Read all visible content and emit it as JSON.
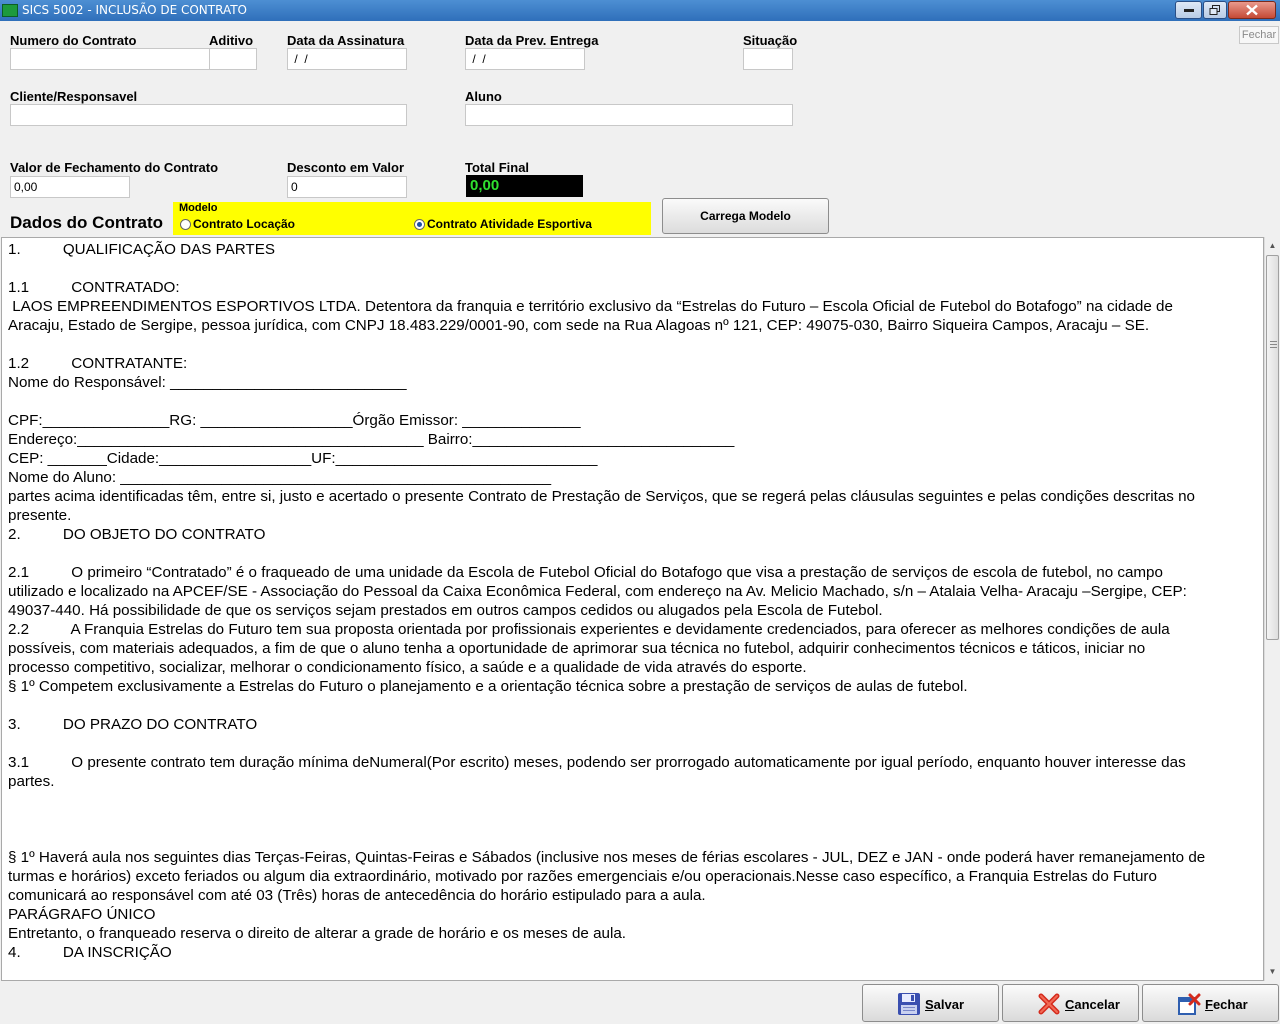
{
  "window": {
    "title": "SICS 5002 - INCLUSÃO DE CONTRATO"
  },
  "form": {
    "numero_label": "Numero do Contrato",
    "numero_value": "",
    "aditivo_label": "Aditivo",
    "aditivo_value": "",
    "data_assinatura_label": "Data da Assinatura",
    "data_assinatura_value": " /  /",
    "data_prev_label": "Data da Prev. Entrega",
    "data_prev_value": " /  /",
    "situacao_label": "Situação",
    "situacao_value": "",
    "cliente_label": "Cliente/Responsavel",
    "cliente_value": "",
    "aluno_label": "Aluno",
    "aluno_value": "",
    "valor_label": "Valor de Fechamento do Contrato",
    "valor_value": "0,00",
    "desconto_label": "Desconto em Valor",
    "desconto_value": "0",
    "total_label": "Total Final",
    "total_value": "0,00",
    "fechar_hint": "Fechar"
  },
  "dados": {
    "title": "Dados do Contrato",
    "modelo_caption": "Modelo",
    "option_locacao": "Contrato Locação",
    "option_atividade": "Contrato Atividade Esportiva",
    "selected": "Contrato Atividade Esportiva",
    "carrega_button": "Carrega Modelo"
  },
  "contract_lines": [
    "1.          QUALIFICAÇÃO DAS PARTES",
    "",
    "1.1          CONTRATADO:",
    " LAOS EMPREENDIMENTOS ESPORTIVOS LTDA. Detentora da franquia e território exclusivo da “Estrelas do Futuro – Escola Oficial de Futebol do Botafogo” na cidade de",
    "Aracaju, Estado de Sergipe, pessoa jurídica, com CNPJ 18.483.229/0001-90, com sede na Rua Alagoas nº 121, CEP: 49075-030, Bairro Siqueira Campos, Aracaju – SE.",
    "",
    "1.2          CONTRATANTE:",
    "Nome do Responsável: ____________________________",
    "",
    "CPF:_______________RG: __________________Órgão Emissor: ______________",
    "Endereço:_________________________________________ Bairro:_______________________________",
    "CEP: _______Cidade:__________________UF:_______________________________",
    "Nome do Aluno: ___________________________________________________",
    "partes acima identificadas têm, entre si, justo e acertado o presente Contrato de Prestação de Serviços, que se regerá pelas cláusulas seguintes e pelas condições descritas no",
    "presente.",
    "2.          DO OBJETO DO CONTRATO",
    "",
    "2.1          O primeiro “Contratado” é o fraqueado de uma unidade da Escola de Futebol Oficial do Botafogo que visa a prestação de serviços de escola de futebol, no campo",
    "utilizado e localizado na APCEF/SE - Associação do Pessoal da Caixa Econômica Federal, com endereço na Av. Melicio Machado, s/n – Atalaia Velha- Aracaju –Sergipe, CEP:",
    "49037-440. Há possibilidade de que os serviços sejam prestados em outros campos cedidos ou alugados pela Escola de Futebol.",
    "2.2          A Franquia Estrelas do Futuro tem sua proposta orientada por profissionais experientes e devidamente credenciados, para oferecer as melhores condições de aula",
    "possíveis, com materiais adequados, a fim de que o aluno tenha a oportunidade de aprimorar sua técnica no futebol, adquirir conhecimentos técnicos e táticos, iniciar no",
    "processo competitivo, socializar, melhorar o condicionamento físico, a saúde e a qualidade de vida através do esporte.",
    "§ 1º Competem exclusivamente a Estrelas do Futuro o planejamento e a orientação técnica sobre a prestação de serviços de aulas de futebol.",
    "",
    "3.          DO PRAZO DO CONTRATO",
    "",
    "3.1          O presente contrato tem duração mínima deNumeral(Por escrito) meses, podendo ser prorrogado automaticamente por igual período, enquanto houver interesse das",
    "partes.",
    "",
    "",
    "",
    "§ 1º Haverá aula nos seguintes dias Terças-Feiras, Quintas-Feiras e Sábados (inclusive nos meses de férias escolares - JUL, DEZ e JAN - onde poderá haver remanejamento de",
    "turmas e horários) exceto feriados ou algum dia extraordinário, motivado por razões emergenciais e/ou operacionais.Nesse caso específico, a Franquia Estrelas do Futuro",
    "comunicará ao responsável com até 03 (Três) horas de antecedência do horário estipulado para a aula.",
    "PARÁGRAFO ÚNICO",
    "Entretanto, o franqueado reserva o direito de alterar a grade de horário e os meses de aula.",
    "4.          DA INSCRIÇÃO"
  ],
  "buttons": {
    "salvar_first": "S",
    "salvar_rest": "alvar",
    "cancelar_first": "C",
    "cancelar_rest": "ancelar",
    "fechar_first": "F",
    "fechar_rest": "echar"
  },
  "icons": {
    "app": "app-icon",
    "salvar": "floppy-disk-icon",
    "cancelar": "red-x-icon",
    "fechar": "exit-door-icon"
  },
  "colors": {
    "modelo_bg": "#ffff00",
    "total_bg": "#000000",
    "total_fg": "#2fe02f"
  }
}
